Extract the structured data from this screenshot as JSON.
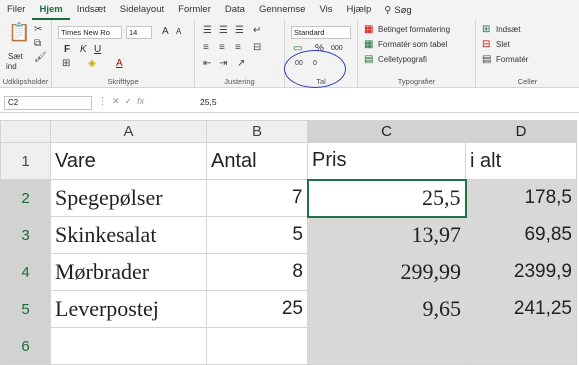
{
  "tabs": [
    "Filer",
    "Hjem",
    "Indsæt",
    "Sidelayout",
    "Formler",
    "Data",
    "Gennemse",
    "Vis",
    "Hjælp"
  ],
  "search_label": "Søg",
  "ribbon": {
    "clipboard": {
      "paste": "Sæt",
      "paste2": "ind",
      "label": "Udklipsholder"
    },
    "font": {
      "name": "Times New Ro",
      "size": "14",
      "bold": "F",
      "italic": "K",
      "underline": "U",
      "grow": "A",
      "shrink": "A",
      "fontcolor": "A",
      "label": "Skrifttype"
    },
    "alignment": {
      "label": "Justering"
    },
    "number": {
      "format": "Standard",
      "percent": "%",
      "thousands": "000",
      "inc": "00",
      "dec": "0",
      "label": "Tal"
    },
    "styles": {
      "conditional": "Betinget formatering",
      "table": "Formatér som tabel",
      "cell": "Celletypografi",
      "label": "Typografier"
    },
    "cells": {
      "insert": "Indsæt",
      "delete": "Slet",
      "format": "Formatér",
      "label": "Celler"
    }
  },
  "formula_bar": {
    "cell_ref": "C2",
    "fx": "fx",
    "value": "25,5"
  },
  "columns": [
    "A",
    "B",
    "C",
    "D"
  ],
  "rows": [
    {
      "n": "1",
      "a": "Vare",
      "b": "Antal",
      "c": "Pris",
      "d": "i alt"
    },
    {
      "n": "2",
      "a": "Spegepølser",
      "b": "7",
      "c": "25,5",
      "d": "178,5"
    },
    {
      "n": "3",
      "a": "Skinkesalat",
      "b": "5",
      "c": "13,97",
      "d": "69,85"
    },
    {
      "n": "4",
      "a": "Mørbrader",
      "b": "8",
      "c": "299,99",
      "d": "2399,9"
    },
    {
      "n": "5",
      "a": "Leverpostej",
      "b": "25",
      "c": "9,65",
      "d": "241,25"
    },
    {
      "n": "6",
      "a": "",
      "b": "",
      "c": "",
      "d": ""
    }
  ],
  "colors": {
    "accent": "#1e6b3a",
    "annotation": "#2b3fb5",
    "selection": "#d8d8d8"
  }
}
